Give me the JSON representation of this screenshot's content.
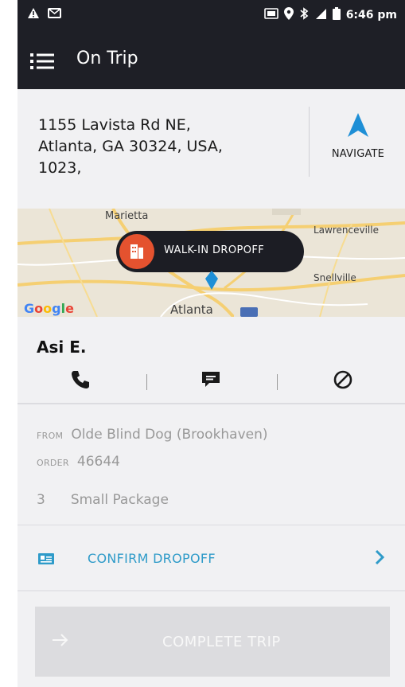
{
  "status_bar": {
    "time": "6:46 pm",
    "icons": [
      "warning-icon",
      "message-icon",
      "cast-icon",
      "location-icon",
      "bluetooth-icon",
      "signal-icon",
      "battery-icon"
    ]
  },
  "app_bar": {
    "title": "On Trip",
    "menu_icon": "menu-icon"
  },
  "address": {
    "line1": "1155 Lavista Rd NE,",
    "line2": "Atlanta, GA 30324, USA,",
    "line3": "1023,"
  },
  "navigate": {
    "label": "NAVIGATE",
    "icon": "navigation-arrow-icon"
  },
  "map": {
    "labels": {
      "marietta": "Marietta",
      "lawrenceville": "Lawrenceville",
      "snellville": "Snellville",
      "atlanta": "Atlanta"
    },
    "callout": "WALK-IN DROPOFF",
    "attribution": "Google"
  },
  "rider": {
    "name": "Asi E.",
    "actions": [
      "phone-icon",
      "message-icon",
      "cancel-icon"
    ]
  },
  "details": {
    "from_key": "FROM",
    "from_value": "Olde Blind Dog (Brookhaven)",
    "order_key": "ORDER",
    "order_value": "46644",
    "package_count": "3",
    "package_type": "Small Package"
  },
  "confirm": {
    "label": "CONFIRM DROPOFF"
  },
  "complete": {
    "label": "COMPLETE TRIP"
  },
  "colors": {
    "app_bar": "#1e1f26",
    "accent_blue": "#2f9bc9",
    "walkin_orange": "#e4522f",
    "navigate_blue": "#1e8fd6",
    "disabled_button": "#dcdcdf"
  }
}
